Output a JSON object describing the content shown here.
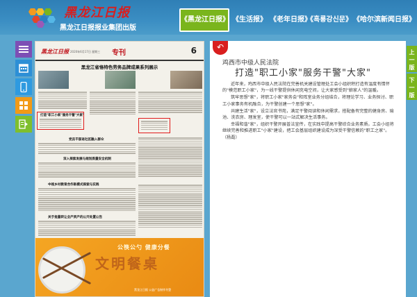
{
  "header": {
    "brand_title": "黑龙江日报",
    "brand_subtitle": "黑龙江日报报业集团出版",
    "tabs": [
      {
        "label": "《黑龙江日报》",
        "active": true
      },
      {
        "label": "《生活报》",
        "active": false
      },
      {
        "label": "《老年日报》",
        "active": false
      },
      {
        "label": "《흑룡강신문》",
        "active": false
      },
      {
        "label": "《哈尔滨新闻日报》",
        "active": false
      }
    ]
  },
  "toolbar": {
    "items": [
      "menu-icon",
      "calendar-icon",
      "mobile-icon",
      "grid-icon",
      "reader-icon"
    ]
  },
  "paper": {
    "masthead": "黑龙江日报",
    "date": "2020年6月17日 星期三",
    "section": "专刊",
    "page_number": "6",
    "headline": "黑龙江省恪特色劳务品牌成果系列展示",
    "highlight_title": "打造\"职工小家\"服务干警\"大家\"",
    "sub_headline_1": "党员干部进社区融入群众",
    "sub_headline_2": "深入探索发展与规划质量安全机制",
    "sub_headline_3": "中视乡村教育合作新模式探索与实践",
    "sub_headline_4": "关于批量转让全产资产的公开处置公告",
    "ad_slogan": "公筷公勺 健康分餐",
    "ad_main": "文明餐桌",
    "ad_footer": "黑龙江日报   公益广告制作刊登"
  },
  "article": {
    "source": "鸡西市中级人民法院",
    "title": "打造\"职工小家\"服务干警\"大家\"",
    "paragraphs": [
      "近年来，鸡西市中级人民法院在完善机关建设管理处工会小组织积打造有温度有情怀的\"模范职工小家\"，为一线干警提供休闲充电空间，让大家感受到\"娘家人\"的温暖。",
      "筑牢思想\"家\"，将职工小家\"家务会\"和阵室业务分组结合，将理论学习、业务探讨、职工小家事务有机融合，为干警创建一个思想\"家\"。",
      "共建生活\"家\"，设立法官书苑，满足干警阅读和休闲需求，搭配备有完整的健身房、瑜池、洗衣房、理发室，使干警可以一站式解决生活事务。",
      "幸福和谐\"家\"，组织干警开展普法宣传，在实践中提高干警综合业务素质。工会小组将继续完善和推进职工\"小家\"建设，把工会基层组织建设成为深受干警信赖的\"职工之家\"。"
    ],
    "signature": "（杨磊）"
  },
  "side_buttons": {
    "prev": "上一版",
    "next": "下一版"
  }
}
